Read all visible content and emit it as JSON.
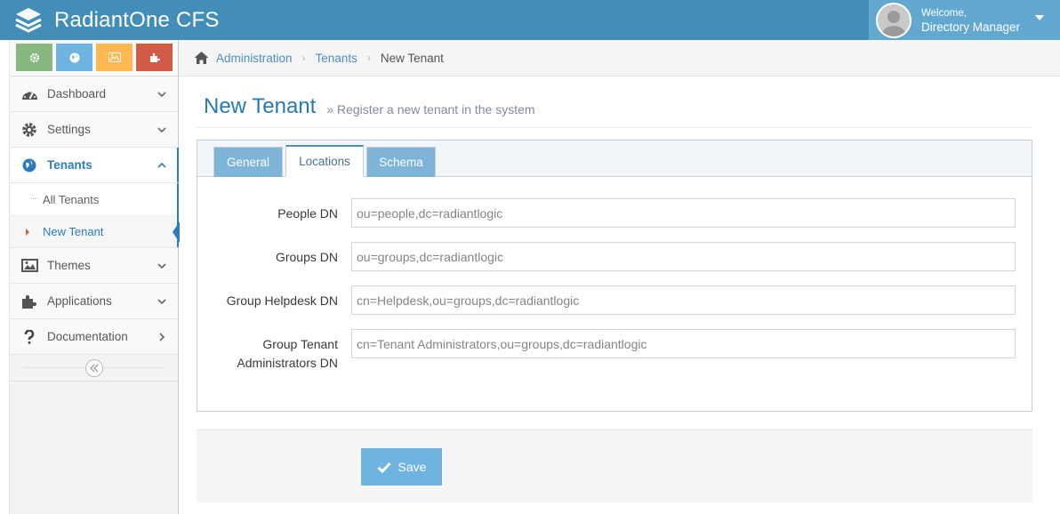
{
  "app": {
    "title": "RadiantOne CFS"
  },
  "user": {
    "welcome": "Welcome,",
    "name": "Directory Manager"
  },
  "sidebar": {
    "items": [
      {
        "label": "Dashboard"
      },
      {
        "label": "Settings"
      },
      {
        "label": "Tenants"
      },
      {
        "label": "Themes"
      },
      {
        "label": "Applications"
      },
      {
        "label": "Documentation"
      }
    ],
    "tenants_sub": [
      {
        "label": "All Tenants"
      },
      {
        "label": "New Tenant"
      }
    ]
  },
  "breadcrumbs": {
    "items": [
      "Administration",
      "Tenants"
    ],
    "current": "New Tenant"
  },
  "page": {
    "title": "New Tenant",
    "subtitle": "Register a new tenant in the system"
  },
  "tabs": [
    {
      "label": "General"
    },
    {
      "label": "Locations"
    },
    {
      "label": "Schema"
    }
  ],
  "form": {
    "people_dn": {
      "label": "People DN",
      "value": "ou=people,dc=radiantlogic"
    },
    "groups_dn": {
      "label": "Groups DN",
      "value": "ou=groups,dc=radiantlogic"
    },
    "group_helpdesk_dn": {
      "label": "Group Helpdesk DN",
      "value": "cn=Helpdesk,ou=groups,dc=radiantlogic"
    },
    "group_tenant_admins_dn": {
      "label_line1": "Group Tenant",
      "label_line2": "Administrators DN",
      "value": "cn=Tenant Administrators,ou=groups,dc=radiantlogic"
    }
  },
  "actions": {
    "save_label": "Save"
  },
  "colors": {
    "navbar": "#438eb9",
    "accent": "#2b7dbc",
    "tab_inactive": "#7db4d8",
    "save": "#6fb3e0"
  },
  "icons": {
    "brand": "layers-icon",
    "avatar": "user-avatar",
    "shortcuts": [
      "cog-icon",
      "globe-icon",
      "picture-icon",
      "puzzle-icon"
    ],
    "nav": [
      "dashboard-icon",
      "gear-icon",
      "globe-icon",
      "picture-icon",
      "puzzle-icon",
      "question-icon"
    ]
  }
}
